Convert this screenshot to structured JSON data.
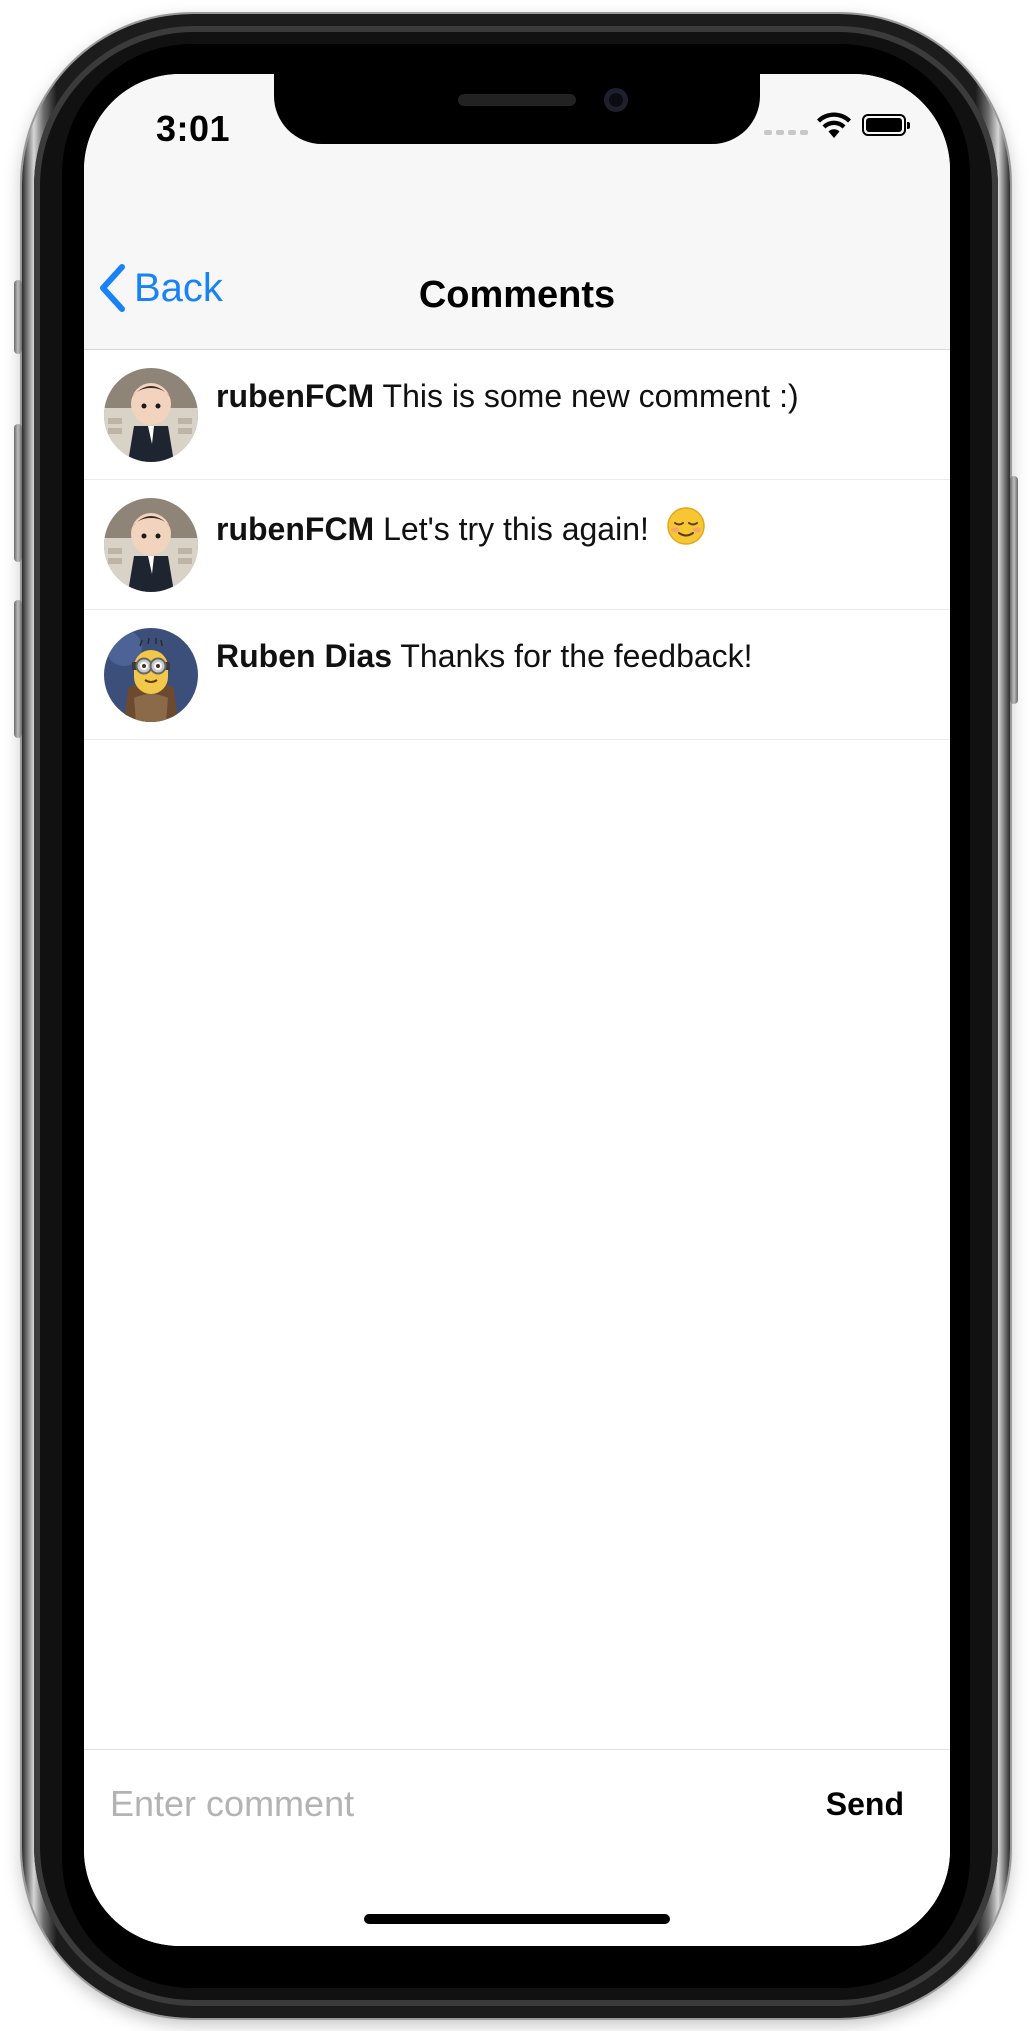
{
  "status_bar": {
    "time": "3:01"
  },
  "nav": {
    "back_label": "Back",
    "title": "Comments"
  },
  "comments": [
    {
      "username": "rubenFCM",
      "text": "This is some new comment :)",
      "avatar": "figurine-avatar"
    },
    {
      "username": "rubenFCM",
      "text": "Let's try this again!",
      "emoji": "relieved-smile-emoji",
      "avatar": "figurine-avatar"
    },
    {
      "username": "Ruben Dias",
      "text": "Thanks for the feedback!",
      "avatar": "minion-avatar"
    }
  ],
  "input": {
    "placeholder": "Enter comment",
    "value": "",
    "send_label": "Send"
  },
  "colors": {
    "accent": "#1a82f7",
    "bar_background": "#f7f7f7",
    "placeholder": "#b3b3b3"
  }
}
